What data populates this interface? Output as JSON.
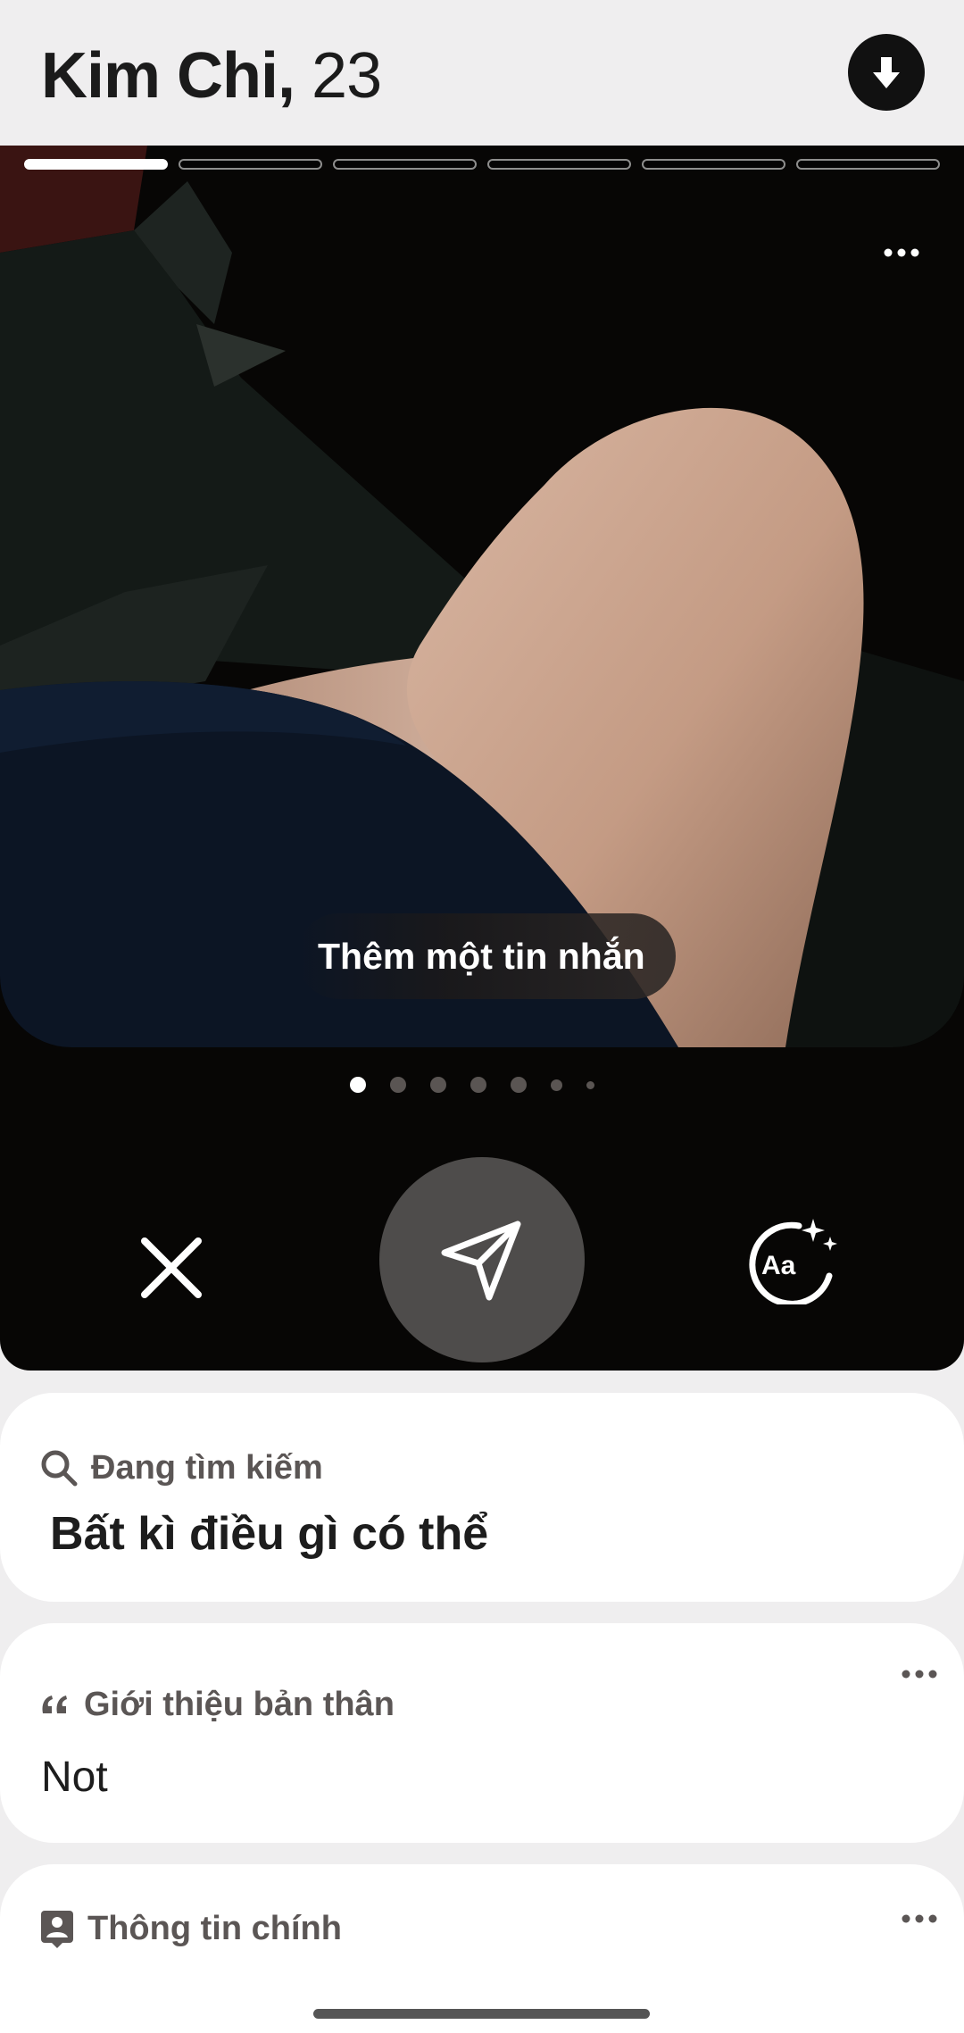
{
  "header": {
    "name": "Kim Chi,",
    "age": "23",
    "download_icon": "arrow-down-circle-icon"
  },
  "photo": {
    "total_photos": 6,
    "active_photo": 1,
    "message_prompt": "Thêm một tin nhắn",
    "more_icon": "more-horizontal-icon"
  },
  "actions": {
    "close_icon": "close-x-icon",
    "send_icon": "paper-plane-icon",
    "ai_icon": "text-sparkle-icon",
    "ai_label": "Aa"
  },
  "looking_for": {
    "icon": "search-icon",
    "title": "Đang tìm kiếm",
    "value": "Bất kì điều gì có thể"
  },
  "about": {
    "icon": "quote-icon",
    "title": "Giới thiệu bản thân",
    "value": "Not"
  },
  "basics": {
    "icon": "profile-card-icon",
    "title": "Thông tin chính"
  },
  "colors": {
    "background": "#efeeef",
    "card_dark": "#070605",
    "send_button": "#4e4c4b",
    "label_gray": "#5b5655"
  }
}
